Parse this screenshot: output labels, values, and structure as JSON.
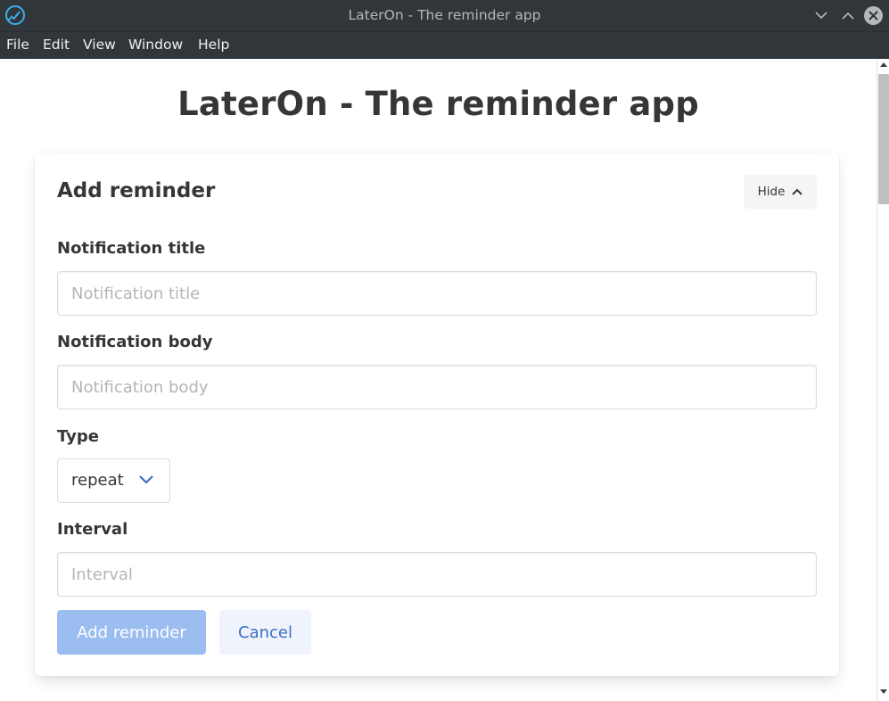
{
  "window": {
    "title": "LaterOn - The reminder app",
    "icons": {
      "app": "laterOn-app-icon",
      "minimize": "chevron-down-icon",
      "maximize": "chevron-up-icon",
      "close": "close-icon"
    }
  },
  "menu": {
    "items": [
      {
        "label": "File"
      },
      {
        "label": "Edit"
      },
      {
        "label": "View"
      },
      {
        "label": "Window"
      },
      {
        "label": "Help"
      }
    ]
  },
  "page": {
    "title": "LaterOn - The reminder app"
  },
  "form": {
    "title": "Add reminder",
    "hide_label": "Hide",
    "notification_title": {
      "label": "Notification title",
      "placeholder": "Notification title",
      "value": ""
    },
    "notification_body": {
      "label": "Notification body",
      "placeholder": "Notification body",
      "value": ""
    },
    "type": {
      "label": "Type",
      "value": "repeat"
    },
    "interval": {
      "label": "Interval",
      "placeholder": "Interval",
      "value": ""
    },
    "submit_label": "Add reminder",
    "cancel_label": "Cancel"
  },
  "colors": {
    "titlebar": "#31363b",
    "primary_disabled": "#9bbdf0",
    "link": "#3e6fc0",
    "accent_icon": "#3daee9"
  }
}
